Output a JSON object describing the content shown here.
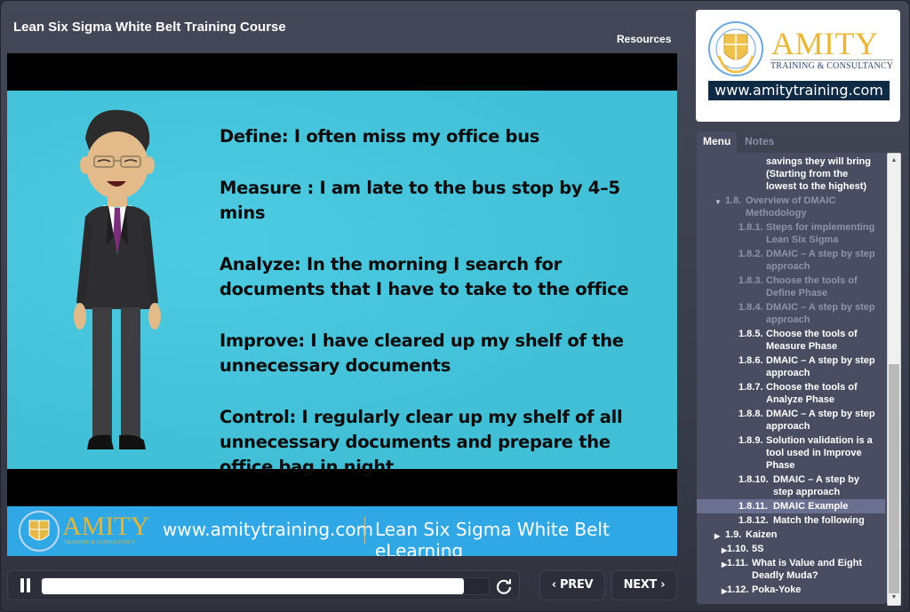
{
  "header": {
    "course_title": "Lean Six Sigma White Belt Training Course",
    "resources_label": "Resources"
  },
  "slide": {
    "lines": [
      "Define:  I often miss my office bus",
      "Measure :   I am late to the bus stop by 4–5 mins",
      "Analyze: In the morning I search for documents that I have to take to the office",
      "Improve: I have cleared up my shelf of the unnecessary documents",
      "Control:  I regularly clear up my shelf of all unnecessary documents and prepare the office bag in night"
    ],
    "banner": {
      "brand": "AMITY",
      "brand_sub": "TRAINING & CONSULTANCY",
      "url": "www.amitytraining.com",
      "course": "Lean Six Sigma White Belt eLearning"
    }
  },
  "controls": {
    "progress_percent": 94.5,
    "prev_label": "PREV",
    "next_label": "NEXT"
  },
  "logo": {
    "brand": "AMITY",
    "tagline": "TRAINING & CONSULTANCY",
    "url": "www.amitytraining.com"
  },
  "tabs": {
    "menu": "Menu",
    "notes": "Notes"
  },
  "menu_items": [
    {
      "num": "",
      "label": "savings they will bring (Starting from the lowest to the highest)",
      "state": "normal",
      "level": 2
    },
    {
      "num": "1.8.",
      "label": "Overview of DMAIC Methodology",
      "state": "dim",
      "level": 1,
      "arrow": "▼"
    },
    {
      "num": "1.8.1.",
      "label": "Steps for implementing Lean Six Sigma",
      "state": "dim",
      "level": 2
    },
    {
      "num": "1.8.2.",
      "label": "DMAIC – A step by step approach",
      "state": "dim",
      "level": 2
    },
    {
      "num": "1.8.3.",
      "label": "Choose the tools of Define Phase",
      "state": "dim",
      "level": 2
    },
    {
      "num": "1.8.4.",
      "label": "DMAIC – A step by step approach",
      "state": "dim",
      "level": 2
    },
    {
      "num": "1.8.5.",
      "label": "Choose the tools of Measure Phase",
      "state": "normal",
      "level": 2
    },
    {
      "num": "1.8.6.",
      "label": "DMAIC – A step by step approach",
      "state": "normal",
      "level": 2
    },
    {
      "num": "1.8.7.",
      "label": "Choose the tools of Analyze Phase",
      "state": "normal",
      "level": 2
    },
    {
      "num": "1.8.8.",
      "label": "DMAIC – A step by step approach",
      "state": "normal",
      "level": 2
    },
    {
      "num": "1.8.9.",
      "label": "Solution validation is a tool used in Improve Phase",
      "state": "normal",
      "level": 2
    },
    {
      "num": "1.8.10.",
      "label": "DMAIC – A step by step approach",
      "state": "normal",
      "level": 2
    },
    {
      "num": "1.8.11.",
      "label": "DMAIC Example",
      "state": "selected",
      "level": 2
    },
    {
      "num": "1.8.12.",
      "label": "Match the following",
      "state": "normal",
      "level": 2
    },
    {
      "num": "1.9.",
      "label": "Kaizen",
      "state": "normal",
      "level": 1,
      "arrow": "▶"
    },
    {
      "num": "1.10.",
      "label": "5S",
      "state": "normal",
      "level": 0,
      "arrow": "▶"
    },
    {
      "num": "1.11.",
      "label": "What is Value and Eight Deadly Muda?",
      "state": "normal",
      "level": 0,
      "arrow": "▶"
    },
    {
      "num": "1.12.",
      "label": "Poka-Yoke",
      "state": "normal",
      "level": 0,
      "arrow": "▶"
    }
  ],
  "colors": {
    "slide_bg": "#44c2da",
    "banner_bg": "#31a8e6",
    "brand_gold": "#e8b835",
    "panel_bg": "#4a4d61",
    "selected_bg": "#6b7090"
  }
}
